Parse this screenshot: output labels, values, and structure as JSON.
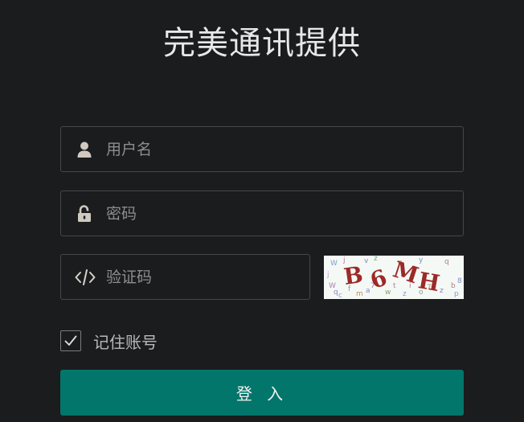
{
  "title": "完美通讯提供",
  "form": {
    "username": {
      "placeholder": "用户名",
      "value": "",
      "icon": "user-icon"
    },
    "password": {
      "placeholder": "密码",
      "value": "",
      "icon": "unlock-icon"
    },
    "captcha": {
      "placeholder": "验证码",
      "value": "",
      "icon": "code-icon"
    },
    "captcha_image_text": "B6MH",
    "remember": {
      "label": "记住账号",
      "checked": true
    },
    "submit_label": "登 入"
  },
  "colors": {
    "background": "#1b1c1e",
    "field_border": "#45474b",
    "accent": "#03766b",
    "captcha_text": "#9c2a28"
  }
}
